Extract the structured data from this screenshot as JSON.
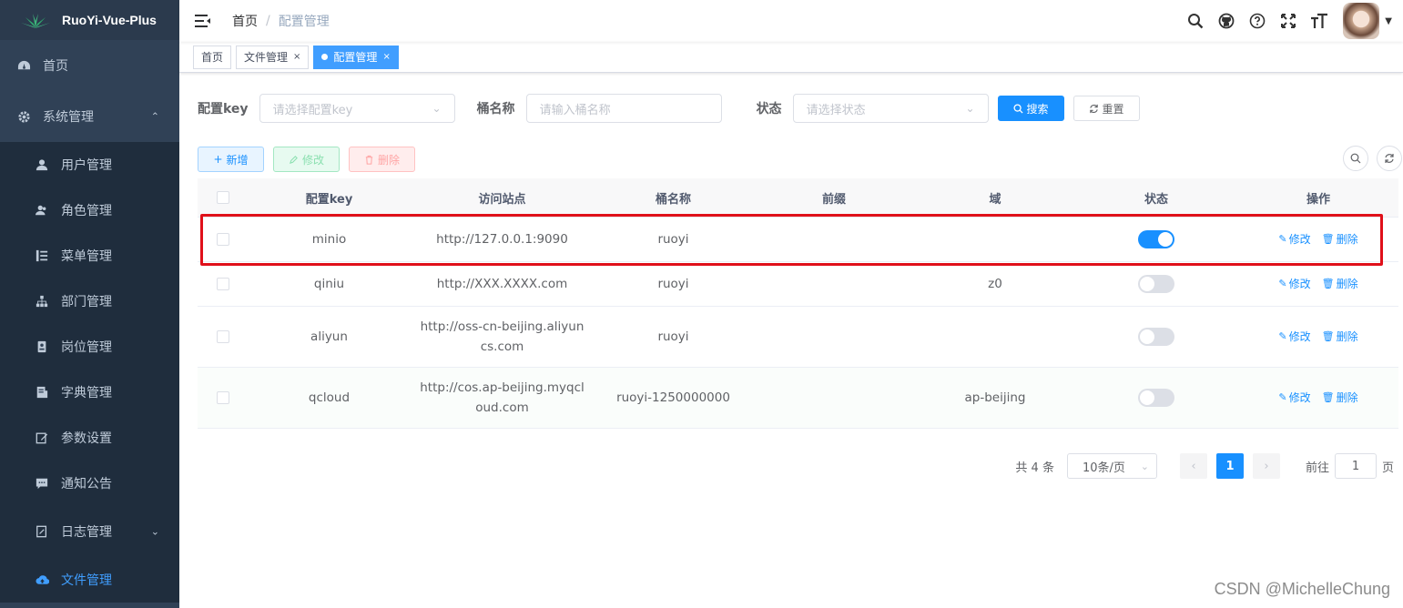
{
  "sidebar": {
    "logo_text": "RuoYi-Vue-Plus",
    "home": "首页",
    "system": "系统管理",
    "items": [
      {
        "label": "用户管理",
        "icon": "user-icon"
      },
      {
        "label": "角色管理",
        "icon": "peoples-icon"
      },
      {
        "label": "菜单管理",
        "icon": "tree-table-icon"
      },
      {
        "label": "部门管理",
        "icon": "tree-icon"
      },
      {
        "label": "岗位管理",
        "icon": "post-icon"
      },
      {
        "label": "字典管理",
        "icon": "dict-icon"
      },
      {
        "label": "参数设置",
        "icon": "edit-icon"
      },
      {
        "label": "通知公告",
        "icon": "message-icon"
      },
      {
        "label": "日志管理",
        "icon": "log-icon"
      },
      {
        "label": "文件管理",
        "icon": "upload-icon"
      }
    ]
  },
  "header": {
    "breadcrumb_home": "首页",
    "breadcrumb_sep": "/",
    "breadcrumb_current": "配置管理"
  },
  "tags": [
    {
      "label": "首页"
    },
    {
      "label": "文件管理",
      "close": "×"
    },
    {
      "label": "配置管理",
      "close": "×"
    }
  ],
  "search": {
    "key_label": "配置key",
    "key_placeholder": "请选择配置key",
    "bucket_label": "桶名称",
    "bucket_placeholder": "请输入桶名称",
    "status_label": "状态",
    "status_placeholder": "请选择状态",
    "search_btn": "搜索",
    "reset_btn": "重置"
  },
  "toolbar": {
    "add": "新增",
    "edit": "修改",
    "delete": "删除"
  },
  "table": {
    "headers": {
      "key": "配置key",
      "site": "访问站点",
      "bucket": "桶名称",
      "prefix": "前缀",
      "domain": "域",
      "status": "状态",
      "ops": "操作"
    },
    "rows": [
      {
        "key": "minio",
        "site": "http://127.0.0.1:9090",
        "bucket": "ruoyi",
        "prefix": "",
        "domain": "",
        "status_on": true
      },
      {
        "key": "qiniu",
        "site": "http://XXX.XXXX.com",
        "bucket": "ruoyi",
        "prefix": "",
        "domain": "z0",
        "status_on": false
      },
      {
        "key": "aliyun",
        "site": "http://oss-cn-beijing.aliyuncs.com",
        "bucket": "ruoyi",
        "prefix": "",
        "domain": "",
        "status_on": false
      },
      {
        "key": "qcloud",
        "site": "http://cos.ap-beijing.myqcloud.com",
        "bucket": "ruoyi-1250000000",
        "prefix": "",
        "domain": "ap-beijing",
        "status_on": false
      }
    ],
    "op_edit": "修改",
    "op_delete": "删除"
  },
  "pagination": {
    "total_text": "共 4 条",
    "page_size": "10条/页",
    "current_page": "1",
    "goto_label": "前往",
    "goto_value": "1",
    "goto_suffix": "页"
  },
  "watermark": "CSDN @MichelleChung",
  "colors": {
    "sidebar_bg": "#304156",
    "primary": "#1890ff",
    "highlight_border": "#e0101a"
  }
}
